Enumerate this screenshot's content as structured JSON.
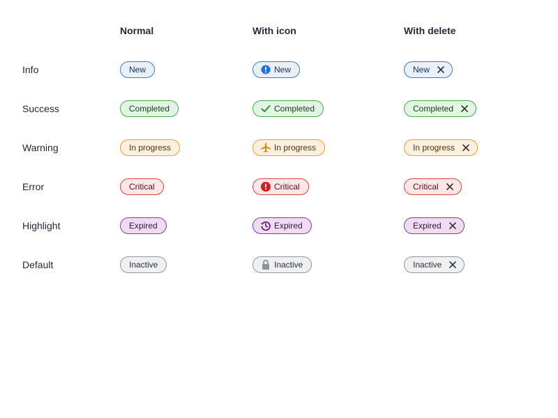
{
  "headers": {
    "normal": "Normal",
    "with_icon": "With icon",
    "with_delete": "With delete"
  },
  "rows": [
    {
      "label": "Info",
      "badge": "New",
      "variant": "info",
      "icon": "info-icon"
    },
    {
      "label": "Success",
      "badge": "Completed",
      "variant": "success",
      "icon": "checkmark-icon"
    },
    {
      "label": "Warning",
      "badge": "In progress",
      "variant": "warning",
      "icon": "airplane-icon"
    },
    {
      "label": "Error",
      "badge": "Critical",
      "variant": "error",
      "icon": "exclamation-icon"
    },
    {
      "label": "Highlight",
      "badge": "Expired",
      "variant": "highlight",
      "icon": "history-icon"
    },
    {
      "label": "Default",
      "badge": "Inactive",
      "variant": "default",
      "icon": "lock-icon"
    }
  ],
  "colors": {
    "info": "#3d7ac4",
    "success": "#49a64f",
    "warning": "#ef9c2e",
    "error": "#d64545",
    "highlight": "#7b3e8f",
    "default": "#8d96a0",
    "delete_icon": "#333333"
  }
}
